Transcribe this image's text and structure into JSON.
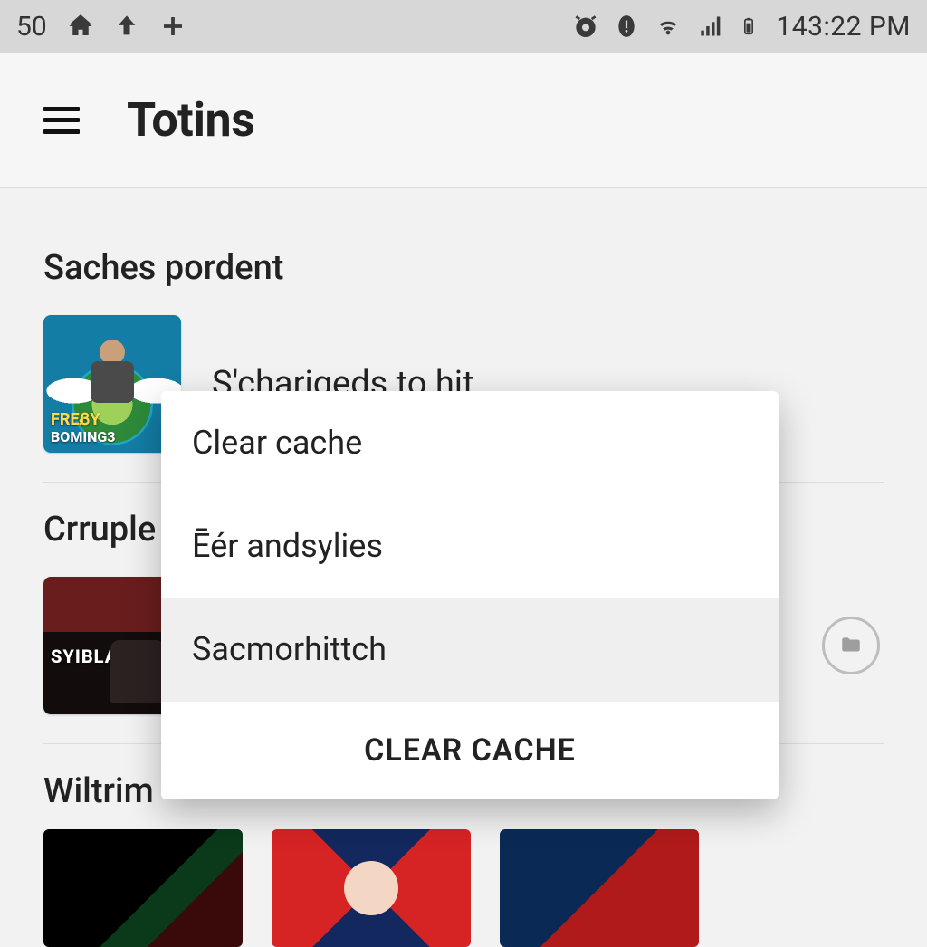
{
  "statusbar": {
    "counter": "50",
    "time": "143:22 PM"
  },
  "appbar": {
    "title": "Totins"
  },
  "sections": [
    {
      "title": "Saches pordent",
      "item_text": "S'charigeds to hit.",
      "thumb": {
        "caption1": "FREᏰY",
        "caption2": "BOMING3"
      }
    },
    {
      "title": "Crruple",
      "thumb": {
        "caption1": "SYIBLAAW",
        "caption2": ""
      }
    },
    {
      "title": "Wiltrim"
    }
  ],
  "popup": {
    "items": [
      {
        "label": "Clear cache",
        "selected": false
      },
      {
        "label": "Ēér andsylies",
        "selected": false
      },
      {
        "label": "Sacmorhittch",
        "selected": true
      }
    ],
    "action": "CLEAR CACHE"
  }
}
